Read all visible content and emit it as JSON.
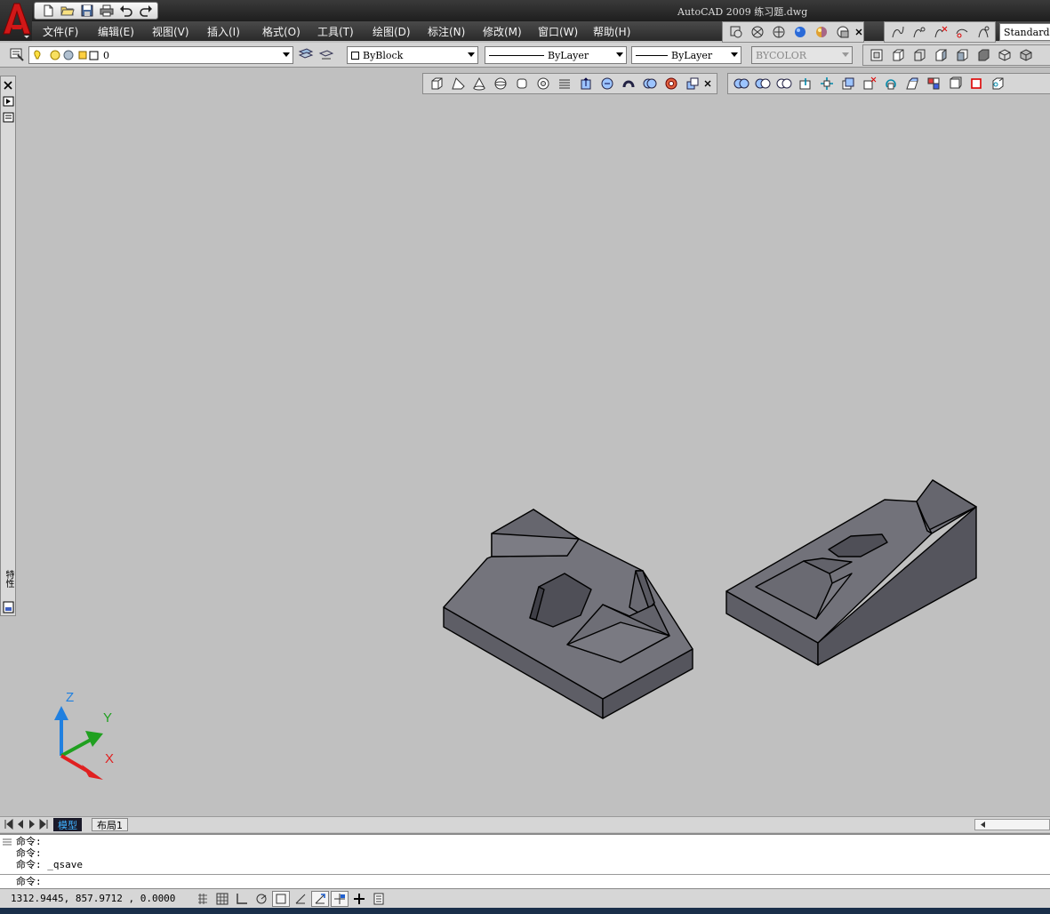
{
  "app": {
    "title": "AutoCAD 2009 练习题.dwg",
    "logo_letter": "A"
  },
  "menu": [
    "文件(F)",
    "编辑(E)",
    "视图(V)",
    "插入(I)",
    "格式(O)",
    "工具(T)",
    "绘图(D)",
    "标注(N)",
    "修改(M)",
    "窗口(W)",
    "帮助(H)"
  ],
  "layers": {
    "current_layer": "0"
  },
  "properties": {
    "color": "ByBlock",
    "linetype": "ByLayer",
    "lineweight": "ByLayer",
    "plotstyle": "BYCOLOR"
  },
  "styles": {
    "text_style": "Standard"
  },
  "palette": {
    "vertical_label": "特性"
  },
  "ucs": {
    "x": "X",
    "y": "Y",
    "z": "Z"
  },
  "layout_tabs": [
    "模型",
    "布局1"
  ],
  "command": {
    "history": [
      "命令:",
      "命令:",
      "命令: _qsave"
    ],
    "prompt": "命令:"
  },
  "status": {
    "coordinates": "1312.9445, 857.9712 , 0.0000"
  },
  "colors": {
    "titlebar": "#2b2b2b",
    "viewport": "#c0c0c0",
    "model_fill": "#6b6b73",
    "model_top": "#7a7a82",
    "axis_x": "#e02020",
    "axis_y": "#20a020",
    "axis_z": "#2080e0"
  }
}
